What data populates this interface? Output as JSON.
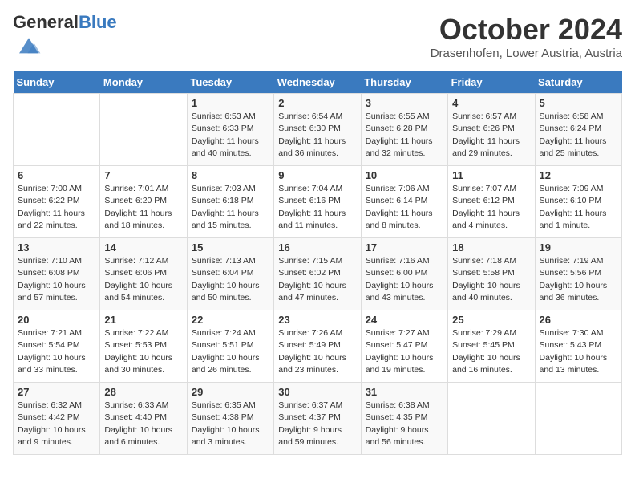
{
  "header": {
    "logo_general": "General",
    "logo_blue": "Blue",
    "month": "October 2024",
    "location": "Drasenhofen, Lower Austria, Austria"
  },
  "days_of_week": [
    "Sunday",
    "Monday",
    "Tuesday",
    "Wednesday",
    "Thursday",
    "Friday",
    "Saturday"
  ],
  "weeks": [
    [
      {
        "day": "",
        "info": ""
      },
      {
        "day": "",
        "info": ""
      },
      {
        "day": "1",
        "info": "Sunrise: 6:53 AM\nSunset: 6:33 PM\nDaylight: 11 hours and 40 minutes."
      },
      {
        "day": "2",
        "info": "Sunrise: 6:54 AM\nSunset: 6:30 PM\nDaylight: 11 hours and 36 minutes."
      },
      {
        "day": "3",
        "info": "Sunrise: 6:55 AM\nSunset: 6:28 PM\nDaylight: 11 hours and 32 minutes."
      },
      {
        "day": "4",
        "info": "Sunrise: 6:57 AM\nSunset: 6:26 PM\nDaylight: 11 hours and 29 minutes."
      },
      {
        "day": "5",
        "info": "Sunrise: 6:58 AM\nSunset: 6:24 PM\nDaylight: 11 hours and 25 minutes."
      }
    ],
    [
      {
        "day": "6",
        "info": "Sunrise: 7:00 AM\nSunset: 6:22 PM\nDaylight: 11 hours and 22 minutes."
      },
      {
        "day": "7",
        "info": "Sunrise: 7:01 AM\nSunset: 6:20 PM\nDaylight: 11 hours and 18 minutes."
      },
      {
        "day": "8",
        "info": "Sunrise: 7:03 AM\nSunset: 6:18 PM\nDaylight: 11 hours and 15 minutes."
      },
      {
        "day": "9",
        "info": "Sunrise: 7:04 AM\nSunset: 6:16 PM\nDaylight: 11 hours and 11 minutes."
      },
      {
        "day": "10",
        "info": "Sunrise: 7:06 AM\nSunset: 6:14 PM\nDaylight: 11 hours and 8 minutes."
      },
      {
        "day": "11",
        "info": "Sunrise: 7:07 AM\nSunset: 6:12 PM\nDaylight: 11 hours and 4 minutes."
      },
      {
        "day": "12",
        "info": "Sunrise: 7:09 AM\nSunset: 6:10 PM\nDaylight: 11 hours and 1 minute."
      }
    ],
    [
      {
        "day": "13",
        "info": "Sunrise: 7:10 AM\nSunset: 6:08 PM\nDaylight: 10 hours and 57 minutes."
      },
      {
        "day": "14",
        "info": "Sunrise: 7:12 AM\nSunset: 6:06 PM\nDaylight: 10 hours and 54 minutes."
      },
      {
        "day": "15",
        "info": "Sunrise: 7:13 AM\nSunset: 6:04 PM\nDaylight: 10 hours and 50 minutes."
      },
      {
        "day": "16",
        "info": "Sunrise: 7:15 AM\nSunset: 6:02 PM\nDaylight: 10 hours and 47 minutes."
      },
      {
        "day": "17",
        "info": "Sunrise: 7:16 AM\nSunset: 6:00 PM\nDaylight: 10 hours and 43 minutes."
      },
      {
        "day": "18",
        "info": "Sunrise: 7:18 AM\nSunset: 5:58 PM\nDaylight: 10 hours and 40 minutes."
      },
      {
        "day": "19",
        "info": "Sunrise: 7:19 AM\nSunset: 5:56 PM\nDaylight: 10 hours and 36 minutes."
      }
    ],
    [
      {
        "day": "20",
        "info": "Sunrise: 7:21 AM\nSunset: 5:54 PM\nDaylight: 10 hours and 33 minutes."
      },
      {
        "day": "21",
        "info": "Sunrise: 7:22 AM\nSunset: 5:53 PM\nDaylight: 10 hours and 30 minutes."
      },
      {
        "day": "22",
        "info": "Sunrise: 7:24 AM\nSunset: 5:51 PM\nDaylight: 10 hours and 26 minutes."
      },
      {
        "day": "23",
        "info": "Sunrise: 7:26 AM\nSunset: 5:49 PM\nDaylight: 10 hours and 23 minutes."
      },
      {
        "day": "24",
        "info": "Sunrise: 7:27 AM\nSunset: 5:47 PM\nDaylight: 10 hours and 19 minutes."
      },
      {
        "day": "25",
        "info": "Sunrise: 7:29 AM\nSunset: 5:45 PM\nDaylight: 10 hours and 16 minutes."
      },
      {
        "day": "26",
        "info": "Sunrise: 7:30 AM\nSunset: 5:43 PM\nDaylight: 10 hours and 13 minutes."
      }
    ],
    [
      {
        "day": "27",
        "info": "Sunrise: 6:32 AM\nSunset: 4:42 PM\nDaylight: 10 hours and 9 minutes."
      },
      {
        "day": "28",
        "info": "Sunrise: 6:33 AM\nSunset: 4:40 PM\nDaylight: 10 hours and 6 minutes."
      },
      {
        "day": "29",
        "info": "Sunrise: 6:35 AM\nSunset: 4:38 PM\nDaylight: 10 hours and 3 minutes."
      },
      {
        "day": "30",
        "info": "Sunrise: 6:37 AM\nSunset: 4:37 PM\nDaylight: 9 hours and 59 minutes."
      },
      {
        "day": "31",
        "info": "Sunrise: 6:38 AM\nSunset: 4:35 PM\nDaylight: 9 hours and 56 minutes."
      },
      {
        "day": "",
        "info": ""
      },
      {
        "day": "",
        "info": ""
      }
    ]
  ]
}
